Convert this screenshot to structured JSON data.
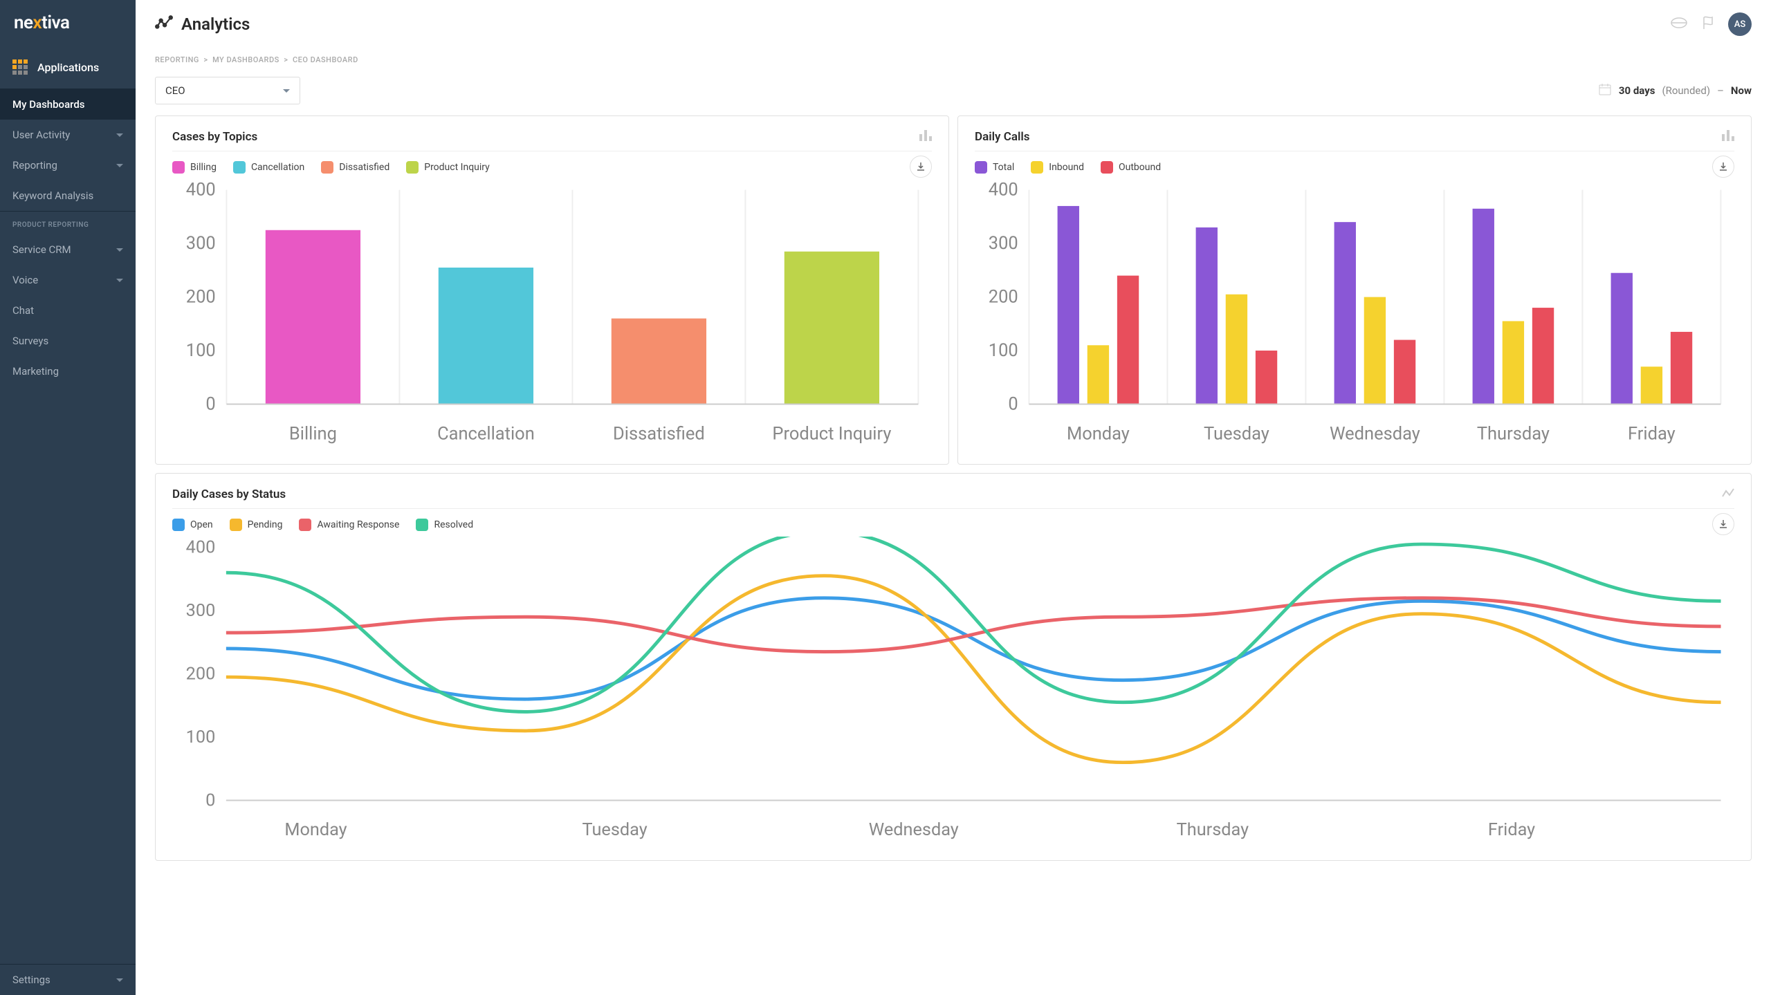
{
  "brand": "nextiva",
  "apps_header": "Applications",
  "sidebar": {
    "items": [
      {
        "label": "My Dashboards",
        "active": true
      },
      {
        "label": "User Activity",
        "expandable": true
      },
      {
        "label": "Reporting",
        "expandable": true
      },
      {
        "label": "Keyword Analysis"
      }
    ],
    "section_label": "Product Reporting",
    "items2": [
      {
        "label": "Service CRM",
        "expandable": true
      },
      {
        "label": "Voice",
        "expandable": true
      },
      {
        "label": "Chat"
      },
      {
        "label": "Surveys"
      },
      {
        "label": "Marketing"
      }
    ],
    "settings": "Settings"
  },
  "header": {
    "title": "Analytics",
    "user_initials": "AS"
  },
  "breadcrumb": [
    "REPORTING",
    "MY DASHBOARDS",
    "CEO DASHBOARD"
  ],
  "dropdown": {
    "selected": "CEO"
  },
  "date_range": {
    "main": "30 days",
    "paren": "(Rounded)",
    "dash": "–",
    "now": "Now"
  },
  "colors": {
    "magenta": "#e858c4",
    "cyan": "#52c7d9",
    "orange": "#f58e6d",
    "lime": "#bdd44a",
    "purple": "#8a57d6",
    "yellow": "#f5d22e",
    "red": "#e84e5c",
    "blue": "#3b9de8",
    "yellow2": "#f5b82e",
    "red2": "#ea6369",
    "green": "#3dc99b"
  },
  "chart_data": [
    {
      "id": "cases_by_topics",
      "title": "Cases by Topics",
      "type": "bar",
      "categories": [
        "Billing",
        "Cancellation",
        "Dissatisfied",
        "Product Inquiry"
      ],
      "series": [
        {
          "name": "Billing",
          "values": [
            325
          ],
          "color": "magenta"
        },
        {
          "name": "Cancellation",
          "values": [
            255
          ],
          "color": "cyan"
        },
        {
          "name": "Dissatisfied",
          "values": [
            160
          ],
          "color": "orange"
        },
        {
          "name": "Product Inquiry",
          "values": [
            285
          ],
          "color": "lime"
        }
      ],
      "legend": [
        "Billing",
        "Cancellation",
        "Dissatisfied",
        "Product Inquiry"
      ],
      "ylim": [
        0,
        400
      ],
      "yticks": [
        0,
        100,
        200,
        300,
        400
      ]
    },
    {
      "id": "daily_calls",
      "title": "Daily Calls",
      "type": "bar",
      "categories": [
        "Monday",
        "Tuesday",
        "Wednesday",
        "Thursday",
        "Friday"
      ],
      "series": [
        {
          "name": "Total",
          "values": [
            370,
            330,
            340,
            365,
            245
          ],
          "color": "purple"
        },
        {
          "name": "Inbound",
          "values": [
            110,
            205,
            200,
            155,
            70
          ],
          "color": "yellow"
        },
        {
          "name": "Outbound",
          "values": [
            240,
            100,
            120,
            180,
            135
          ],
          "color": "red"
        }
      ],
      "ylim": [
        0,
        400
      ],
      "yticks": [
        0,
        100,
        200,
        300,
        400
      ]
    },
    {
      "id": "daily_cases_by_status",
      "title": "Daily Cases by Status",
      "type": "line",
      "categories": [
        "Monday",
        "Tuesday",
        "Wednesday",
        "Thursday",
        "Friday"
      ],
      "series": [
        {
          "name": "Open",
          "values": [
            240,
            160,
            320,
            190,
            315,
            235
          ],
          "color": "blue"
        },
        {
          "name": "Pending",
          "values": [
            195,
            110,
            355,
            60,
            295,
            155
          ],
          "color": "yellow2"
        },
        {
          "name": "Awaiting Response",
          "values": [
            265,
            290,
            235,
            290,
            320,
            275
          ],
          "color": "red2"
        },
        {
          "name": "Resolved",
          "values": [
            360,
            140,
            425,
            155,
            405,
            315
          ],
          "color": "green"
        }
      ],
      "ylim": [
        0,
        400
      ],
      "yticks": [
        0,
        100,
        200,
        300,
        400
      ]
    }
  ]
}
